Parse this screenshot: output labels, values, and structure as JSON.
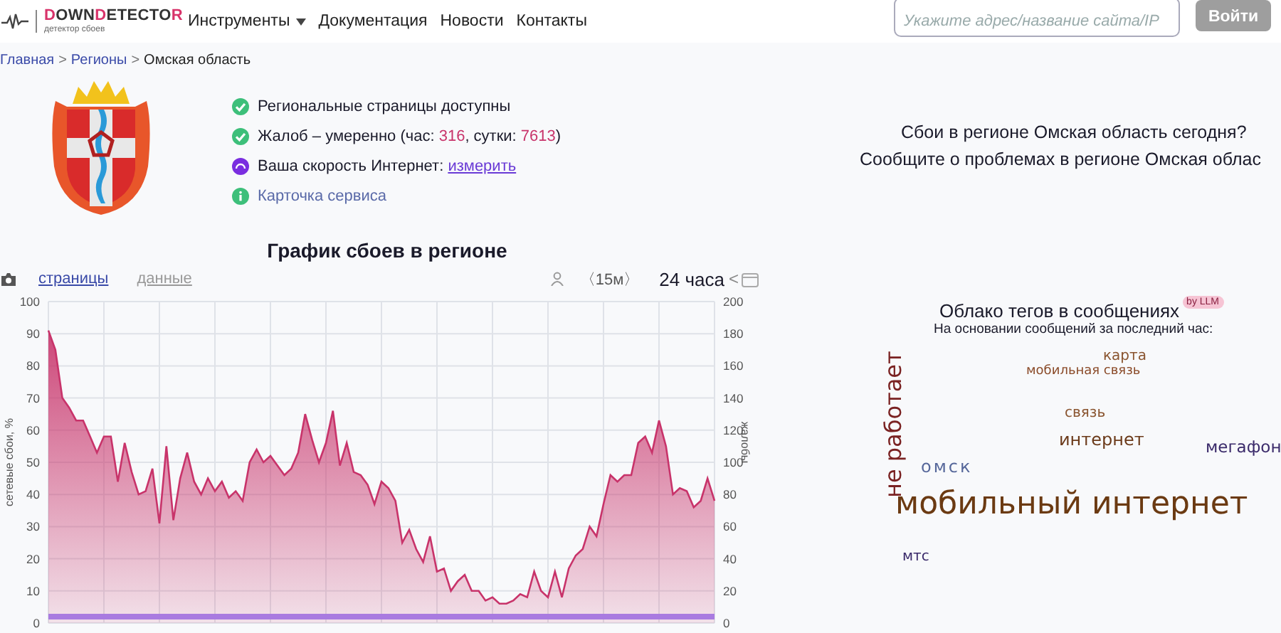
{
  "header": {
    "logo": [
      {
        "text": "D",
        "accent": true
      },
      {
        "text": "OWN",
        "accent": false
      },
      {
        "text": "D",
        "accent": true
      },
      {
        "text": "ETECTO",
        "accent": false
      },
      {
        "text": "R",
        "accent": true
      }
    ],
    "logo_subtitle": "детектор сбоев",
    "nav": [
      {
        "label": "Инструменты",
        "dropdown": true
      },
      {
        "label": "Документация",
        "dropdown": false
      },
      {
        "label": "Новости",
        "dropdown": false
      },
      {
        "label": "Контакты",
        "dropdown": false
      }
    ],
    "search": {
      "placeholder": "Укажите адрес/название сайта/IP"
    },
    "login_button": "Войти"
  },
  "breadcrumbs": [
    {
      "label": "Главная",
      "kind": "link"
    },
    {
      "label": ">",
      "kind": "separator"
    },
    {
      "label": "Регионы",
      "kind": "link"
    },
    {
      "label": ">",
      "kind": "separator"
    },
    {
      "label": "Омская область",
      "kind": "current"
    }
  ],
  "status": [
    {
      "kind": "ok",
      "parts": [
        {
          "text": "Региональные страницы доступны",
          "kind": "plain"
        }
      ]
    },
    {
      "kind": "ok",
      "parts": [
        {
          "text": "Жалоб – умеренно (час: ",
          "kind": "plain"
        },
        {
          "text": "316",
          "kind": "number"
        },
        {
          "text": ", сутки: ",
          "kind": "plain"
        },
        {
          "text": "7613",
          "kind": "number"
        },
        {
          "text": ")",
          "kind": "plain"
        }
      ]
    },
    {
      "kind": "speed",
      "parts": [
        {
          "text": "Ваша скорость Интернет: ",
          "kind": "plain"
        },
        {
          "text": "измерить",
          "kind": "link"
        }
      ]
    },
    {
      "kind": "info",
      "parts": [
        {
          "text": "Карточка сервиса",
          "kind": "link"
        }
      ]
    }
  ],
  "chart_section": {
    "title": "График сбоев в регионе",
    "view_tabs": [
      {
        "label": "страницы",
        "selected": true
      },
      {
        "label": "данные",
        "selected": false
      }
    ],
    "interval": "〈15м〉",
    "period": "24 часа",
    "prev": "<",
    "right_axis": {
      "title": "жалобы",
      "ticks": [
        "200",
        "180",
        "160",
        "140",
        "120",
        "100",
        "80",
        "60",
        "40",
        "20",
        "0"
      ]
    },
    "chart_data": {
      "type": "area",
      "ylabel": "сетевые сбои, %",
      "ylim": [
        0,
        100
      ],
      "grid": true,
      "yticks": [
        0,
        10,
        20,
        30,
        40,
        50,
        60,
        70,
        80,
        90,
        100
      ],
      "series": [
        {
          "type": "area",
          "color": "#c8336a",
          "values": [
            91,
            85,
            70,
            67,
            63,
            63,
            58,
            53,
            58,
            58,
            44,
            56,
            47,
            40,
            41,
            48,
            31,
            55,
            32,
            45,
            53,
            44,
            40,
            45,
            41,
            44,
            39,
            41,
            38,
            50,
            54,
            50,
            52,
            49,
            46,
            48,
            53,
            65,
            57,
            50,
            56,
            66,
            49,
            56,
            47,
            46,
            43,
            37,
            44,
            42,
            38,
            25,
            29,
            23,
            19,
            27,
            16,
            17,
            10,
            13,
            15,
            10,
            10,
            7,
            8,
            6,
            6,
            7,
            9,
            8,
            16,
            10,
            8,
            16,
            8,
            17,
            21,
            23,
            30,
            27,
            37,
            46,
            44,
            46,
            46,
            56,
            58,
            53,
            63,
            55,
            40,
            42,
            41,
            36,
            38,
            45,
            38
          ]
        },
        {
          "type": "line",
          "color": "#a97be0",
          "values": [
            2,
            2,
            2,
            2,
            2,
            2,
            2,
            2,
            2,
            2,
            2,
            2,
            2,
            2,
            2,
            2,
            2,
            2,
            2,
            2,
            2,
            2,
            2,
            2,
            2,
            2,
            2,
            2,
            2,
            2,
            2,
            2,
            2,
            2,
            2,
            2,
            2,
            2,
            2,
            2,
            2,
            2,
            2,
            2,
            2,
            2,
            2,
            2,
            2,
            2,
            2,
            2,
            2,
            2,
            2,
            2,
            2,
            2,
            2,
            2,
            2,
            2,
            2,
            2,
            2,
            2,
            2,
            2,
            2,
            2,
            2,
            2,
            2,
            2,
            2,
            2,
            2,
            2,
            2,
            2,
            2,
            2,
            2,
            2,
            2,
            2,
            2,
            2,
            2,
            2,
            2,
            2,
            2,
            2,
            2,
            2,
            2
          ]
        }
      ]
    }
  },
  "region": {
    "headline": "Сбои в регионе Омская область сегодня?",
    "report_prompt": "Сообщите о проблемах в регионе Омская облас"
  },
  "tag_cloud": {
    "title": "Облако тегов в сообщениях",
    "badge": "by LLM",
    "subtitle": "На основании сообщений за последний час:",
    "tags": [
      {
        "text": "карта",
        "color": "#8a5530",
        "vertical": false
      },
      {
        "text": "мобильная связь",
        "color": "#8a4a28",
        "vertical": false
      },
      {
        "text": "связь",
        "color": "#8a5530",
        "vertical": false
      },
      {
        "text": "интернет",
        "color": "#6b3a1a",
        "vertical": false
      },
      {
        "text": "мегафон",
        "color": "#3a2a6a",
        "vertical": false
      },
      {
        "text": "омск",
        "color": "#56679a",
        "vertical": false
      },
      {
        "text": "не работает",
        "color": "#7a2222",
        "vertical": true
      },
      {
        "text": "мобильный интернет",
        "color": "#6b3a12",
        "vertical": false
      },
      {
        "text": "мтс",
        "color": "#3a2a6a",
        "vertical": false
      }
    ]
  }
}
